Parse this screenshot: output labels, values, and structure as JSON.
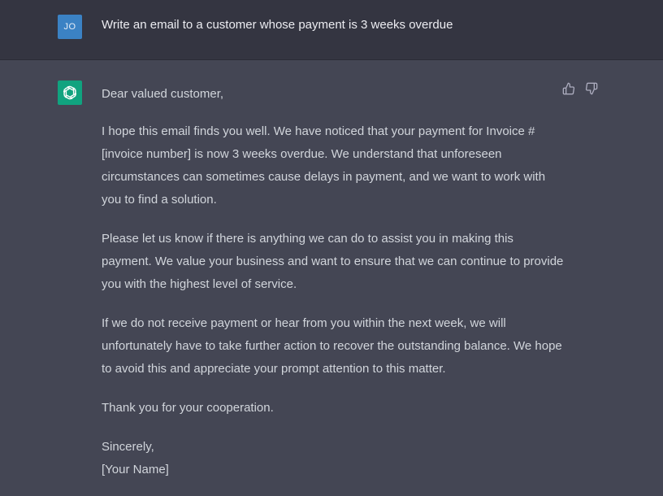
{
  "user_message": {
    "avatar_initials": "JO",
    "avatar_color": "#3b82c4",
    "text": "Write an email to a customer whose payment is 3 weeks overdue"
  },
  "assistant_message": {
    "avatar_icon": "openai-logo-icon",
    "avatar_color": "#10a37f",
    "greeting": "Dear valued customer,",
    "paragraphs": [
      "I hope this email finds you well. We have noticed that your payment for Invoice #[invoice number] is now 3 weeks overdue. We understand that unforeseen circumstances can sometimes cause delays in payment, and we want to work with you to find a solution.",
      "Please let us know if there is anything we can do to assist you in making this payment. We value your business and want to ensure that we can continue to provide you with the highest level of service.",
      "If we do not receive payment or hear from you within the next week, we will unfortunately have to take further action to recover the outstanding balance. We hope to avoid this and appreciate your prompt attention to this matter.",
      "Thank you for your cooperation."
    ],
    "signoff": "Sincerely,",
    "signature": "[Your Name]",
    "feedback_icons": [
      "thumbs-up-icon",
      "thumbs-down-icon"
    ]
  },
  "colors": {
    "user_row_bg": "#343541",
    "assistant_row_bg": "#444654",
    "text": "#d1d5db"
  }
}
